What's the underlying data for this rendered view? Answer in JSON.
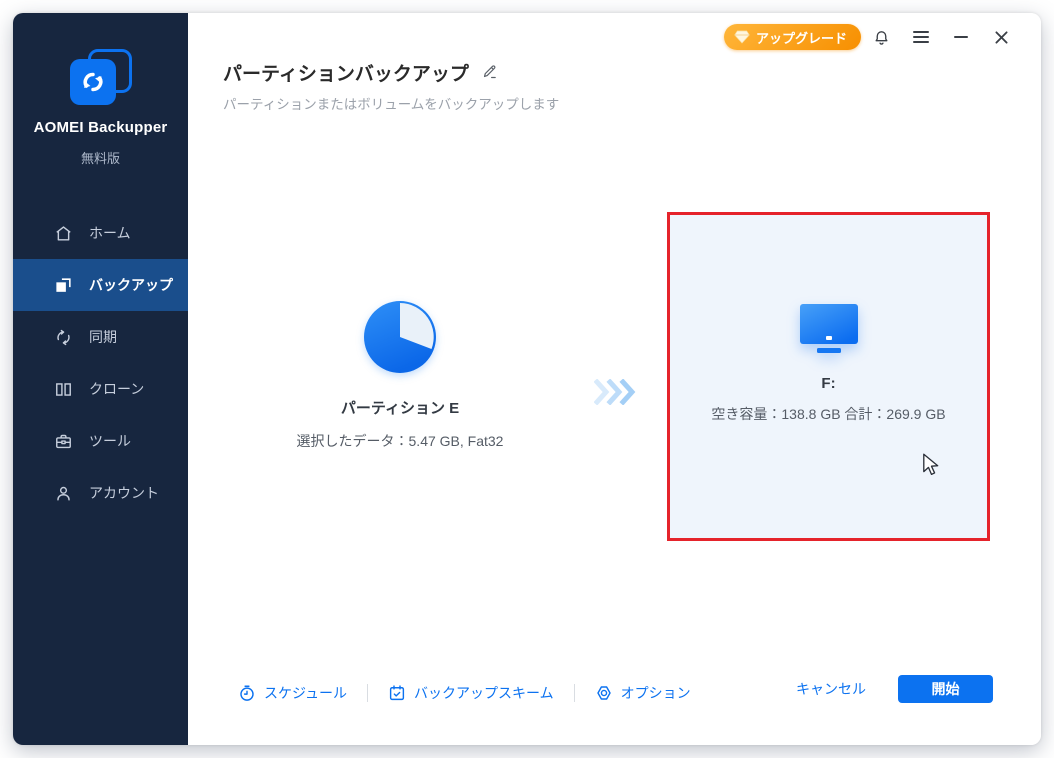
{
  "app": {
    "name": "AOMEI Backupper",
    "edition": "無料版"
  },
  "topbar": {
    "upgrade_label": "アップグレード",
    "bell_icon": "notification-bell",
    "menu_icon": "hamburger-menu",
    "minimize_glyph": "—",
    "close_glyph": "✕"
  },
  "sidebar": {
    "items": [
      {
        "icon": "home-icon",
        "label": "ホーム",
        "active": false
      },
      {
        "icon": "backup-icon",
        "label": "バックアップ",
        "active": true
      },
      {
        "icon": "sync-icon",
        "label": "同期",
        "active": false
      },
      {
        "icon": "clone-icon",
        "label": "クローン",
        "active": false
      },
      {
        "icon": "tools-icon",
        "label": "ツール",
        "active": false
      },
      {
        "icon": "account-icon",
        "label": "アカウント",
        "active": false
      }
    ]
  },
  "header": {
    "title": "パーティションバックアップ",
    "subtitle": "パーティションまたはボリュームをバックアップします"
  },
  "source": {
    "icon": "pie-chart-partition",
    "name": "パーティション E",
    "detail": "選択したデータ：5.47 GB, Fat32"
  },
  "target": {
    "icon": "disk-monitor",
    "name": "F:",
    "detail": "空き容量：138.8 GB 合計：269.9 GB",
    "highlighted": true
  },
  "footer": {
    "schedule_label": "スケジュール",
    "scheme_label": "バックアップスキーム",
    "options_label": "オプション",
    "cancel_label": "キャンセル",
    "start_label": "開始"
  },
  "colors": {
    "accent_blue": "#0C72F0",
    "sidebar_bg": "#17263F",
    "sidebar_active_bg": "#1A4E8C",
    "upgrade_orange": "#F78F00",
    "target_border_red": "#E5232B",
    "target_bg": "#EFF5FC"
  }
}
